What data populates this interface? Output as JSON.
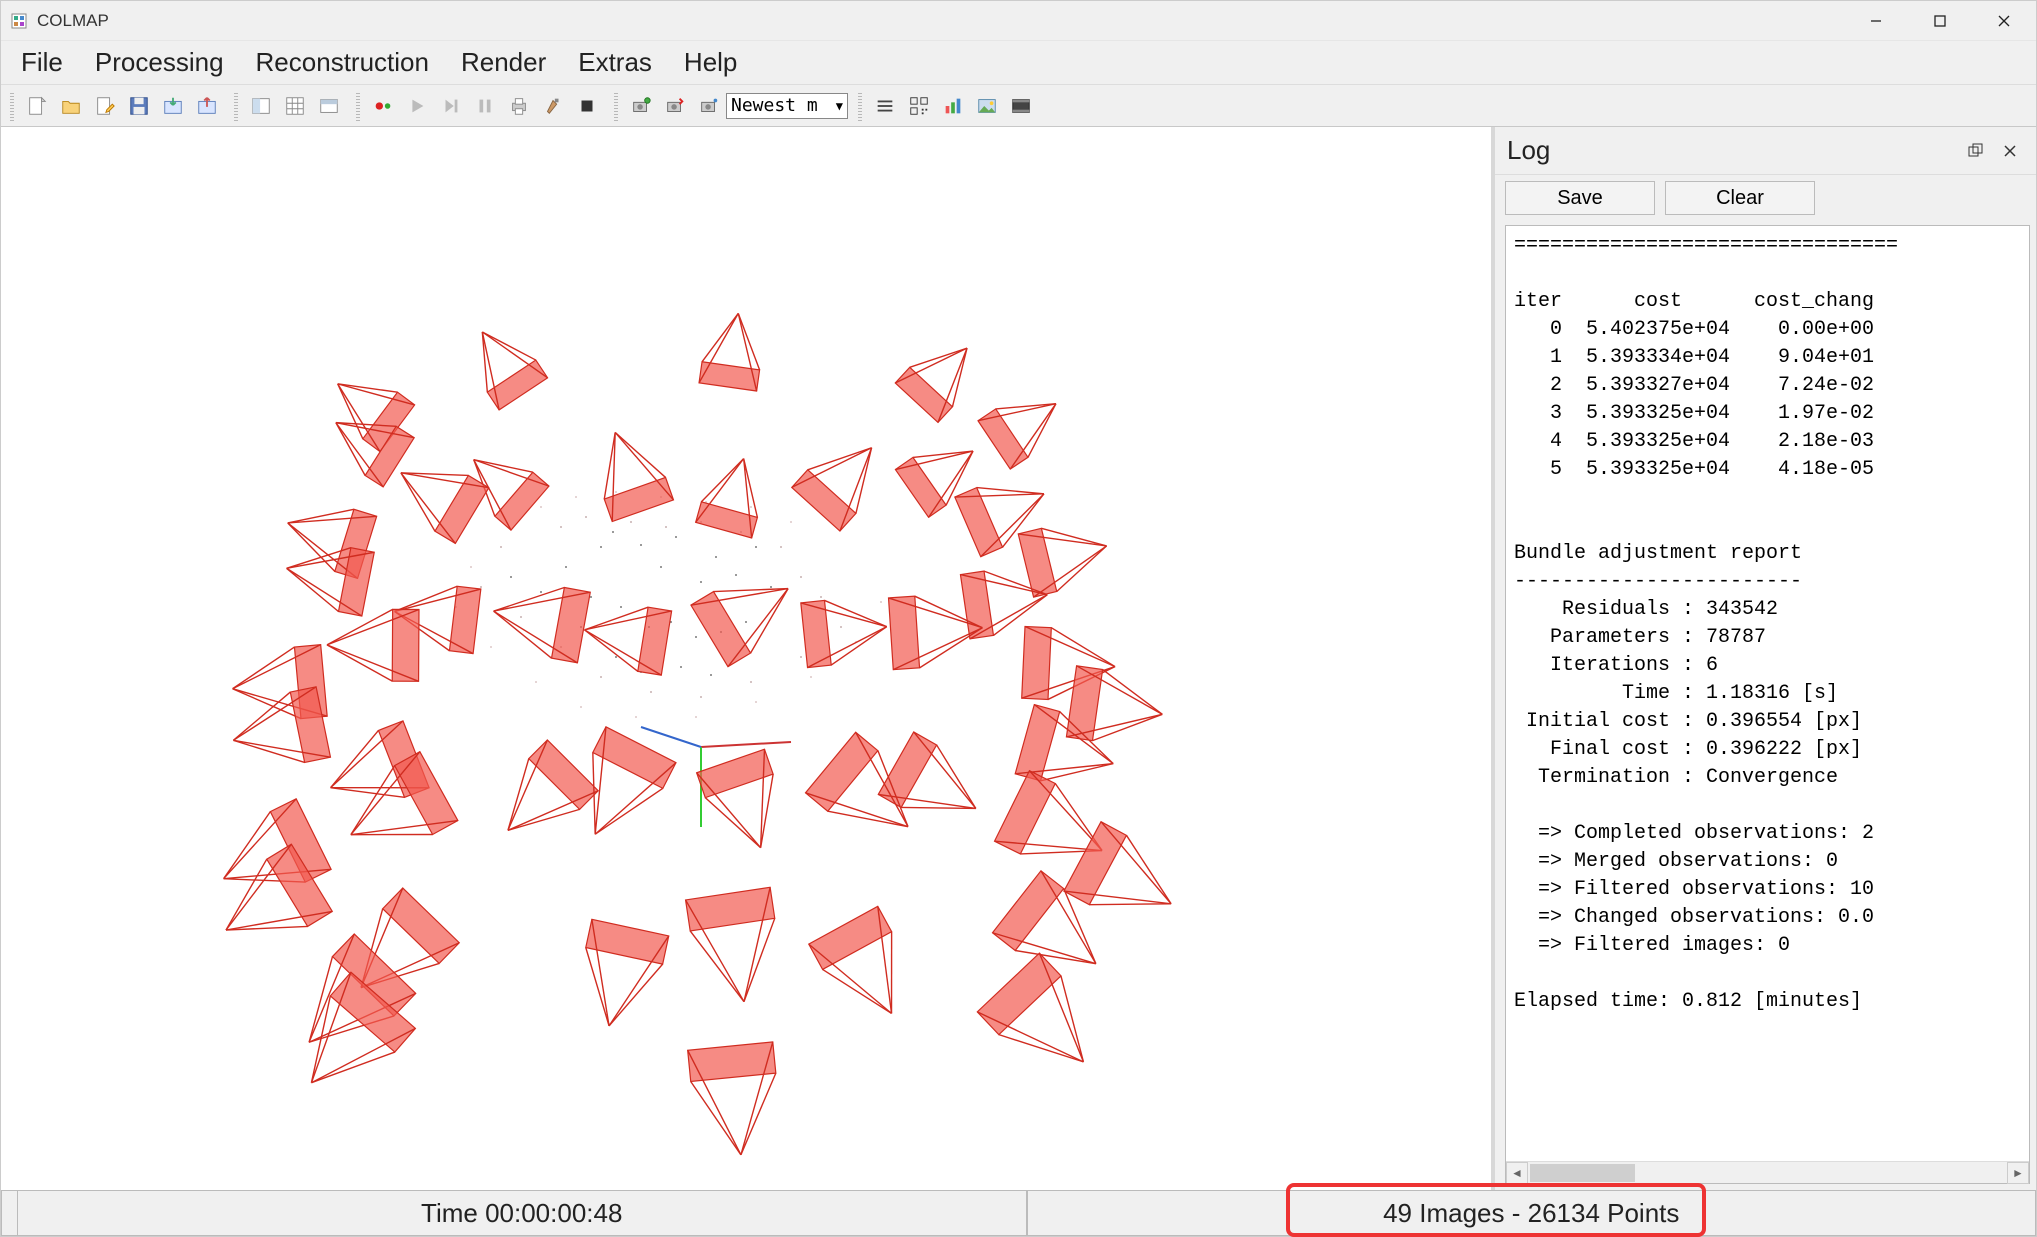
{
  "app": {
    "title": "COLMAP"
  },
  "menu": {
    "file": "File",
    "processing": "Processing",
    "reconstruction": "Reconstruction",
    "render": "Render",
    "extras": "Extras",
    "help": "Help"
  },
  "toolbar": {
    "model_selector": "Newest m",
    "icons": [
      "new-project",
      "open-project",
      "edit-project",
      "save-project",
      "import-model",
      "export-model",
      "feature-extraction",
      "table-view",
      "match-visualization",
      "start-reconstruction",
      "play",
      "step",
      "pause",
      "stop-print",
      "bundle-adjust",
      "dense-reconstruction",
      "dense-fuse",
      "dense-stereo",
      "dense-mesh",
      "model-dropdown",
      "render-options",
      "grab-image",
      "grab-movie",
      "show-points",
      "show-cameras"
    ]
  },
  "log": {
    "title": "Log",
    "save": "Save",
    "clear": "Clear",
    "text": "================================\n\niter      cost      cost_chang\n   0  5.402375e+04    0.00e+00\n   1  5.393334e+04    9.04e+01\n   2  5.393327e+04    7.24e-02\n   3  5.393325e+04    1.97e-02\n   4  5.393325e+04    2.18e-03\n   5  5.393325e+04    4.18e-05\n\n\nBundle adjustment report\n------------------------\n    Residuals : 343542\n   Parameters : 78787\n   Iterations : 6\n         Time : 1.18316 [s]\n Initial cost : 0.396554 [px]\n   Final cost : 0.396222 [px]\n  Termination : Convergence\n\n  => Completed observations: 2\n  => Merged observations: 0\n  => Filtered observations: 10\n  => Changed observations: 0.0\n  => Filtered images: 0\n\nElapsed time: 0.812 [minutes]\n"
  },
  "status": {
    "time_label": "Time 00:00:00:48",
    "images_points": "49 Images - 26134 Points"
  },
  "colors": {
    "camera": "#f25a50",
    "camera_stroke": "#d02c20"
  }
}
